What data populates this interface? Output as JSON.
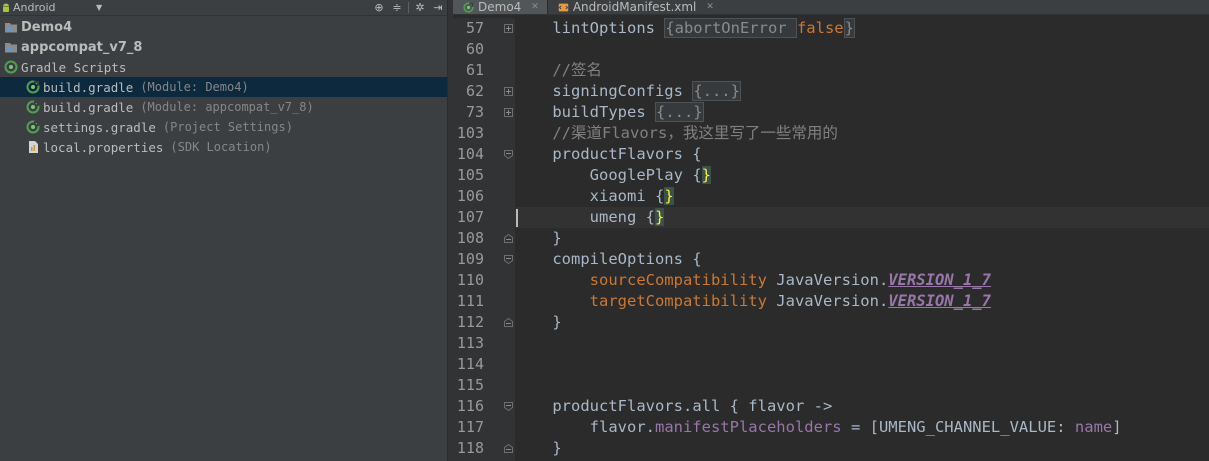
{
  "project_panel": {
    "view_label": "Android",
    "tree": [
      {
        "name": "Demo4",
        "hint": "",
        "icon": "module-folder-icon",
        "bold": true,
        "selected": false
      },
      {
        "name": "appcompat_v7_8",
        "hint": "",
        "icon": "module-folder-icon",
        "bold": true,
        "selected": false
      },
      {
        "name": "Gradle Scripts",
        "hint": "",
        "icon": "gradle-scripts-icon",
        "bold": false,
        "selected": false
      },
      {
        "name": "build.gradle",
        "hint": "(Module: Demo4)",
        "icon": "gradle-file-icon",
        "bold": false,
        "selected": true
      },
      {
        "name": "build.gradle",
        "hint": "(Module: appcompat_v7_8)",
        "icon": "gradle-file-icon",
        "bold": false,
        "selected": false
      },
      {
        "name": "settings.gradle",
        "hint": "(Project Settings)",
        "icon": "gradle-file-icon",
        "bold": false,
        "selected": false
      },
      {
        "name": "local.properties",
        "hint": "(SDK Location)",
        "icon": "properties-file-icon",
        "bold": false,
        "selected": false
      }
    ]
  },
  "tabs": [
    {
      "label": "Demo4",
      "icon": "gradle-file-icon",
      "active": true
    },
    {
      "label": "AndroidManifest.xml",
      "icon": "xml-file-icon",
      "active": false
    }
  ],
  "editor": {
    "caret_line": 9,
    "lines": [
      {
        "num": "57",
        "fold": "plus",
        "tokens": [
          {
            "t": "    lintOptions ",
            "c": "k-plain"
          },
          {
            "t": "{abortOnError ",
            "c": "k-fold"
          },
          {
            "t": "false",
            "c": "k-field"
          },
          {
            "t": "}",
            "c": "k-fold"
          }
        ]
      },
      {
        "num": "60",
        "fold": "",
        "tokens": []
      },
      {
        "num": "61",
        "fold": "",
        "tokens": [
          {
            "t": "    //签名",
            "c": "k-cmt"
          }
        ]
      },
      {
        "num": "62",
        "fold": "plus",
        "tokens": [
          {
            "t": "    signingConfigs ",
            "c": "k-plain"
          },
          {
            "t": "{...}",
            "c": "k-fold"
          }
        ]
      },
      {
        "num": "73",
        "fold": "plus",
        "tokens": [
          {
            "t": "    buildTypes ",
            "c": "k-plain"
          },
          {
            "t": "{...}",
            "c": "k-fold"
          }
        ]
      },
      {
        "num": "103",
        "fold": "",
        "tokens": [
          {
            "t": "    //渠道Flavors，我这里写了一些常用的",
            "c": "k-cmt"
          }
        ]
      },
      {
        "num": "104",
        "fold": "open",
        "tokens": [
          {
            "t": "    productFlavors {",
            "c": "k-plain"
          }
        ]
      },
      {
        "num": "105",
        "fold": "",
        "tokens": [
          {
            "t": "        GooglePlay ",
            "c": "k-plain"
          },
          {
            "t": "{",
            "c": "k-plain"
          },
          {
            "t": "}",
            "c": "k-brace"
          }
        ]
      },
      {
        "num": "106",
        "fold": "",
        "tokens": [
          {
            "t": "        xiaomi ",
            "c": "k-plain"
          },
          {
            "t": "{",
            "c": "k-plain"
          },
          {
            "t": "}",
            "c": "k-brace"
          }
        ]
      },
      {
        "num": "107",
        "fold": "",
        "tokens": [
          {
            "t": "        umeng ",
            "c": "k-plain"
          },
          {
            "t": "{",
            "c": "k-plain"
          },
          {
            "t": "}",
            "c": "k-brace"
          }
        ]
      },
      {
        "num": "108",
        "fold": "close",
        "tokens": [
          {
            "t": "    }",
            "c": "k-plain"
          }
        ]
      },
      {
        "num": "109",
        "fold": "open",
        "tokens": [
          {
            "t": "    compileOptions {",
            "c": "k-plain"
          }
        ]
      },
      {
        "num": "110",
        "fold": "",
        "tokens": [
          {
            "t": "        ",
            "c": "k-plain"
          },
          {
            "t": "sourceCompatibility",
            "c": "k-field"
          },
          {
            "t": " JavaVersion.",
            "c": "k-plain"
          },
          {
            "t": "VERSION_1_7",
            "c": "k-static"
          }
        ]
      },
      {
        "num": "111",
        "fold": "",
        "tokens": [
          {
            "t": "        ",
            "c": "k-plain"
          },
          {
            "t": "targetCompatibility",
            "c": "k-field"
          },
          {
            "t": " JavaVersion.",
            "c": "k-plain"
          },
          {
            "t": "VERSION_1_7",
            "c": "k-static"
          }
        ]
      },
      {
        "num": "112",
        "fold": "close",
        "tokens": [
          {
            "t": "    }",
            "c": "k-plain"
          }
        ]
      },
      {
        "num": "113",
        "fold": "",
        "tokens": []
      },
      {
        "num": "114",
        "fold": "",
        "tokens": []
      },
      {
        "num": "115",
        "fold": "",
        "tokens": []
      },
      {
        "num": "116",
        "fold": "open",
        "tokens": [
          {
            "t": "    productFlavors.",
            "c": "k-plain"
          },
          {
            "t": "all",
            "c": "k-plain"
          },
          {
            "t": " { flavor ->",
            "c": "k-plain"
          }
        ]
      },
      {
        "num": "117",
        "fold": "",
        "tokens": [
          {
            "t": "        flavor.",
            "c": "k-plain"
          },
          {
            "t": "manifestPlaceholders",
            "c": "k-prop"
          },
          {
            "t": " = [UMENG_CHANNEL_VALUE: ",
            "c": "k-plain"
          },
          {
            "t": "name",
            "c": "k-prop"
          },
          {
            "t": "]",
            "c": "k-plain"
          }
        ]
      },
      {
        "num": "118",
        "fold": "close",
        "tokens": [
          {
            "t": "    }",
            "c": "k-plain"
          }
        ]
      }
    ]
  }
}
